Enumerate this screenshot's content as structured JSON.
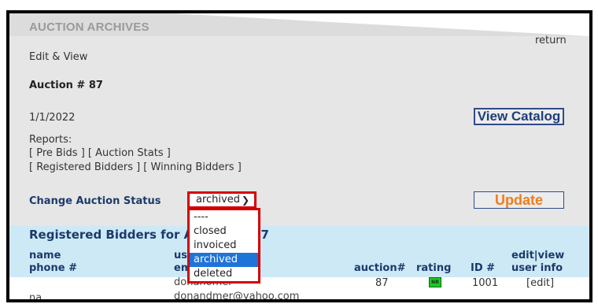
{
  "header": {
    "title": "AUCTION ARCHIVES",
    "return_label": "return"
  },
  "page": {
    "subtitle": "Edit & View",
    "auction_heading": "Auction # 87",
    "date": "1/1/2022",
    "view_catalog_label": "View Catalog"
  },
  "reports": {
    "label": "Reports:",
    "row1": "[ Pre Bids ]  [ Auction Stats ]",
    "row2": "[ Registered Bidders ]  [ Winning Bidders ]"
  },
  "status": {
    "label": "Change Auction Status",
    "selected": "archived",
    "options": [
      "----",
      "closed",
      "invoiced",
      "archived",
      "deleted"
    ],
    "update_label": "Update"
  },
  "bidders": {
    "title": "Registered Bidders for Auction # 87",
    "columns": {
      "name": "name",
      "phone": "phone #",
      "user": "user",
      "email": "email",
      "auction": "auction#",
      "rating": "rating",
      "id": "ID #",
      "edit_view": "edit|view",
      "user_info": "user info"
    },
    "rows": [
      {
        "name": "donahomer",
        "email": "donandmer@yahoo.com",
        "phone": "na",
        "auction": "87",
        "rating_badge": "NR",
        "id": "1001",
        "edit": "[edit]"
      }
    ]
  },
  "colors": {
    "accent_red": "#d40000",
    "selected_blue": "#1e74d8",
    "update_orange": "#f07d1a",
    "panel_blue": "#cde9f6",
    "rating_green": "#22c32a"
  }
}
